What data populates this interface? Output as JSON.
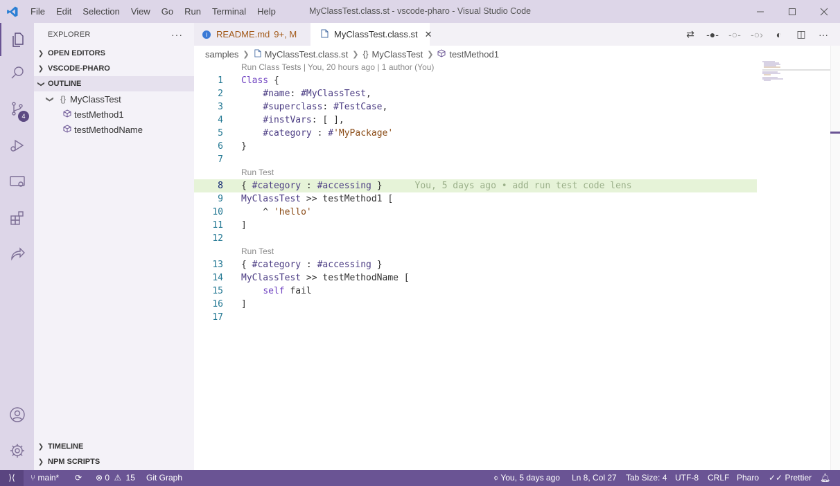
{
  "window": {
    "title": "MyClassTest.class.st - vscode-pharo - Visual Studio Code",
    "menu": [
      "File",
      "Edit",
      "Selection",
      "View",
      "Go",
      "Run",
      "Terminal",
      "Help"
    ]
  },
  "sidebar": {
    "title": "EXPLORER",
    "sections": {
      "open_editors": "OPEN EDITORS",
      "project": "VSCODE-PHARO",
      "outline": "OUTLINE",
      "timeline": "TIMELINE",
      "npm_scripts": "NPM SCRIPTS"
    },
    "outline_items": [
      {
        "label": "MyClassTest",
        "icon": "braces-icon"
      },
      {
        "label": "testMethod1",
        "icon": "method-cube-icon"
      },
      {
        "label": "testMethodName",
        "icon": "method-cube-icon"
      }
    ]
  },
  "activity": {
    "scm_badge": "4"
  },
  "tabs": [
    {
      "label": "README.md",
      "status": "9+, M"
    },
    {
      "label": "MyClassTest.class.st"
    }
  ],
  "breadcrumbs": [
    "samples",
    "MyClassTest.class.st",
    "MyClassTest",
    "testMethod1"
  ],
  "codelens": {
    "class": "Run Class Tests | You, 20 hours ago | 1 author (You)",
    "method1": "Run Test",
    "method2": "Run Test"
  },
  "blame": "You, 5 days ago • add run test code lens",
  "line_numbers": [
    "1",
    "2",
    "3",
    "4",
    "5",
    "6",
    "7",
    "8",
    "9",
    "10",
    "11",
    "12",
    "13",
    "14",
    "15",
    "16",
    "17"
  ],
  "status": {
    "branch": "main*",
    "errors": "0",
    "warnings": "15",
    "git_graph": "Git Graph",
    "blame": "You, 5 days ago",
    "position": "Ln 8, Col 27",
    "tab_size": "Tab Size: 4",
    "encoding": "UTF-8",
    "eol": "CRLF",
    "language": "Pharo",
    "formatter": "Prettier"
  },
  "colors": {
    "accent": "#6a5494",
    "titlebar": "#ddd6e8",
    "highlight_line": "#e6f3d8"
  }
}
